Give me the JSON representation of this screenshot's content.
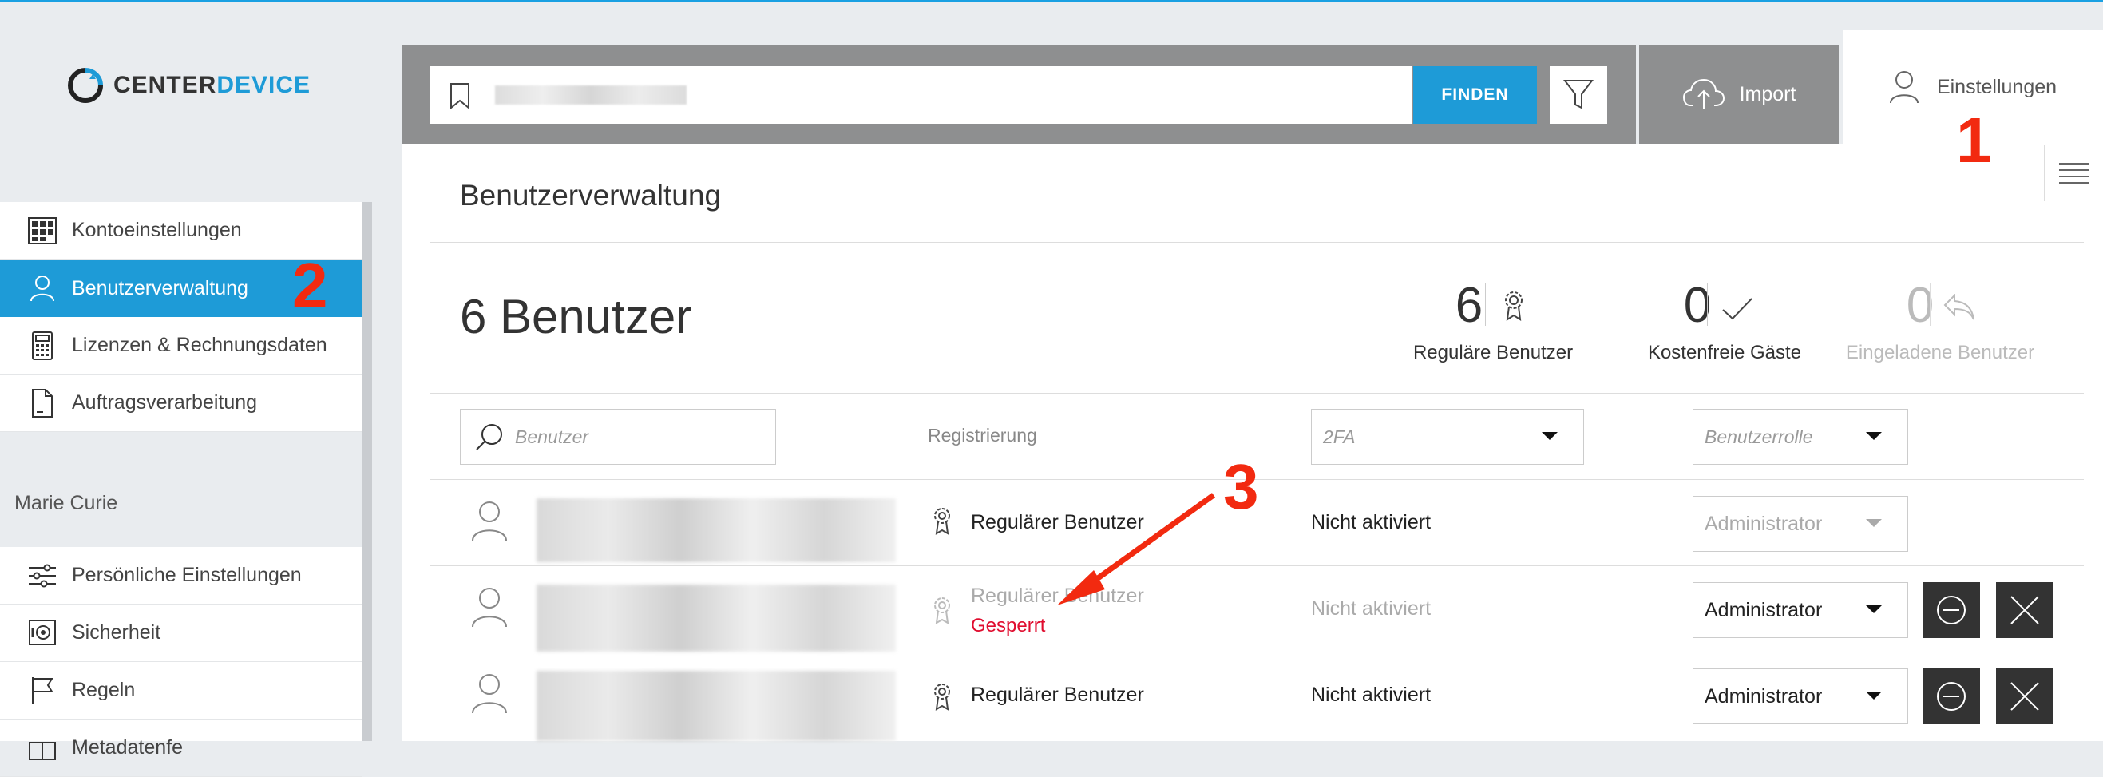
{
  "app": {
    "logo_prefix": "CENTER",
    "logo_suffix": "DEVICE"
  },
  "search": {
    "placeholder": "",
    "find_label": "FINDEN"
  },
  "header": {
    "import_label": "Import",
    "settings_label": "Einstellungen"
  },
  "sidebar": {
    "items": [
      {
        "label": "Kontoeinstellungen",
        "icon": "grid-icon"
      },
      {
        "label": "Benutzerverwaltung",
        "icon": "user-icon",
        "active": true
      },
      {
        "label": "Lizenzen & Rechnungsdaten",
        "icon": "calculator-icon"
      },
      {
        "label": "Auftragsverarbeitung",
        "icon": "document-icon"
      }
    ],
    "user_name": "Marie Curie",
    "user_items": [
      {
        "label": "Persönliche Einstellungen",
        "icon": "sliders-icon"
      },
      {
        "label": "Sicherheit",
        "icon": "safe-icon"
      },
      {
        "label": "Regeln",
        "icon": "flag-icon"
      },
      {
        "label": "Metadatenfe",
        "icon": "table-icon"
      }
    ]
  },
  "main": {
    "title": "Benutzerverwaltung",
    "count_title": "6 Benutzer",
    "stats": [
      {
        "value": "6",
        "label": "Reguläre Benutzer",
        "icon": "award-icon"
      },
      {
        "value": "0",
        "label": "Kostenfreie Gäste",
        "icon": "check-icon"
      },
      {
        "value": "0",
        "label": "Eingeladene Benutzer",
        "icon": "reply-icon"
      }
    ],
    "filters": {
      "user_placeholder": "Benutzer",
      "registration_label": "Registrierung",
      "twofa_placeholder": "2FA",
      "role_placeholder": "Benutzerrolle"
    },
    "rows": [
      {
        "type": "Regulärer Benutzer",
        "status": "",
        "twofa": "Nicht aktiviert",
        "role": "Administrator",
        "role_disabled": true
      },
      {
        "type": "Regulärer Benutzer",
        "status": "Gesperrt",
        "twofa": "Nicht aktiviert",
        "role": "Administrator",
        "role_disabled": false
      },
      {
        "type": "Regulärer Benutzer",
        "status": "",
        "twofa": "Nicht aktiviert",
        "role": "Administrator",
        "role_disabled": false
      }
    ]
  },
  "annotations": [
    "1",
    "2",
    "3"
  ],
  "colors": {
    "accent": "#1e9bd7",
    "annotation": "#f22a10",
    "locked": "#e00d2f"
  }
}
